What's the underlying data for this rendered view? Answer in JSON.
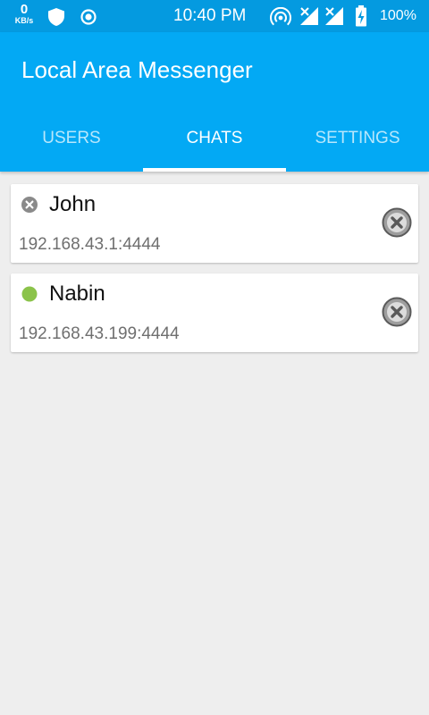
{
  "status_bar": {
    "speed_value": "0",
    "speed_unit": "KB/s",
    "time": "10:40 PM",
    "battery": "100%",
    "icons": [
      "shield-icon",
      "record-circle-icon",
      "hotspot-icon",
      "signal-no-data-icon",
      "signal-no-data-icon",
      "battery-charging-icon"
    ]
  },
  "app_bar": {
    "title": "Local Area Messenger",
    "tabs": [
      {
        "label": "USERS",
        "active": false
      },
      {
        "label": "CHATS",
        "active": true
      },
      {
        "label": "SETTINGS",
        "active": false
      }
    ]
  },
  "chats": [
    {
      "name": "John",
      "address": "192.168.43.1:4444",
      "status": "offline",
      "status_icon": "offline-x-icon"
    },
    {
      "name": "Nabin",
      "address": "192.168.43.199:4444",
      "status": "online",
      "status_icon": "online-dot-icon"
    }
  ],
  "colors": {
    "status_bar": "#049ae0",
    "primary": "#03a9f4",
    "background": "#eeeeee",
    "online": "#8bc34a",
    "offline": "#8a8a8a"
  }
}
